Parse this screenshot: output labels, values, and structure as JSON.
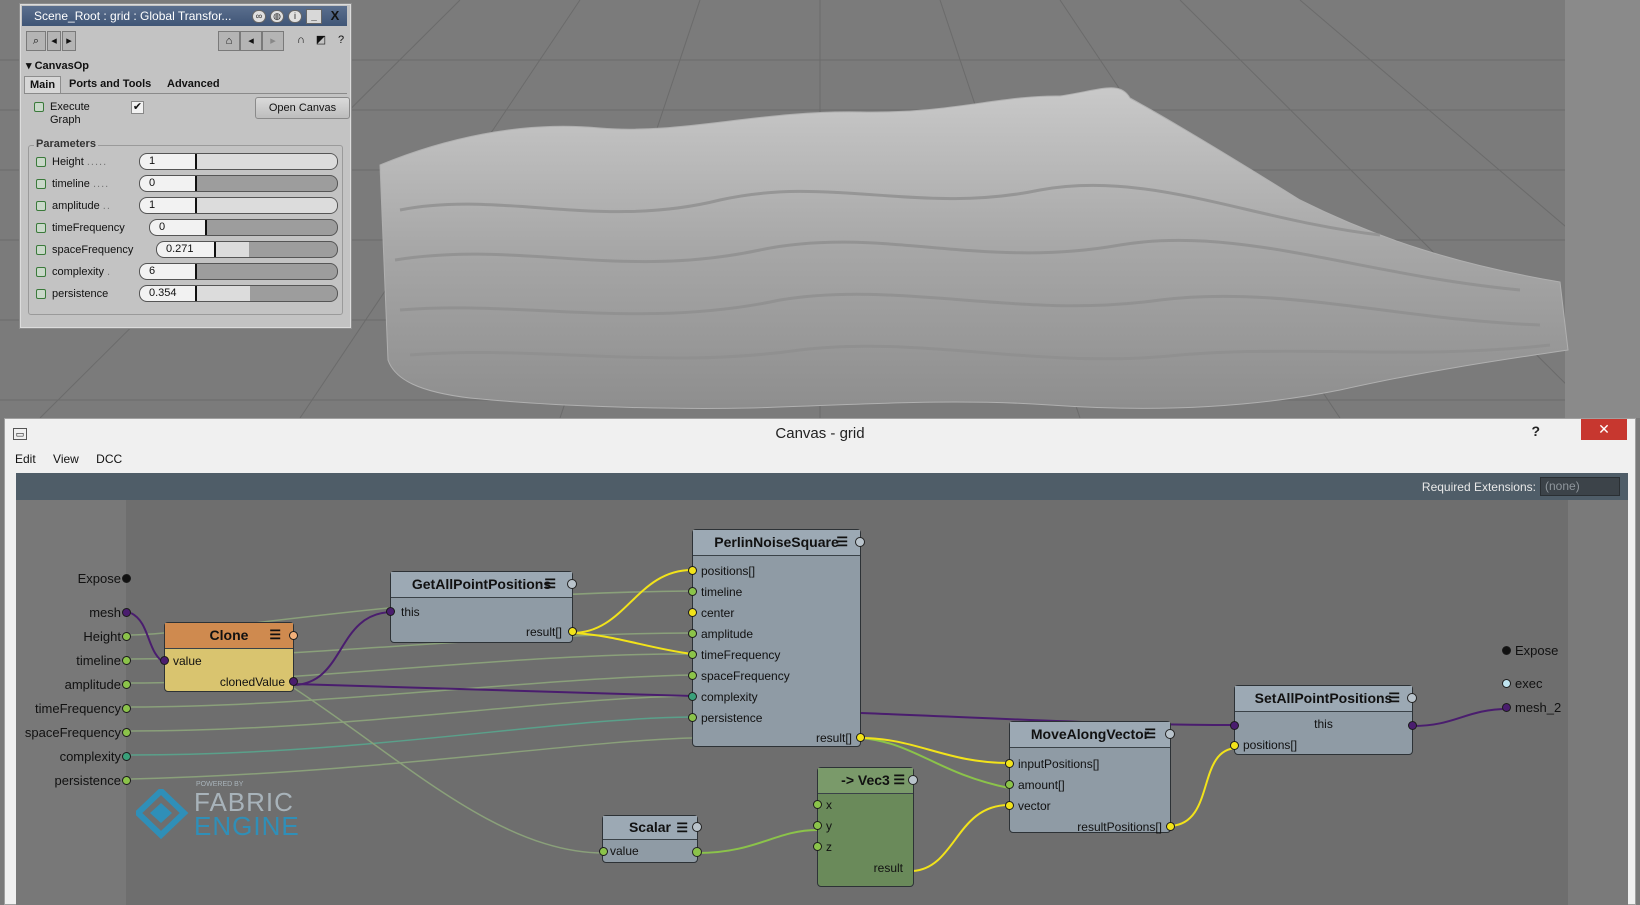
{
  "prop_panel": {
    "title": "Scene_Root : grid : Global Transfor...",
    "section": "CanvasOp",
    "tabs": [
      "Main",
      "Ports and Tools",
      "Advanced"
    ],
    "execute_label": "Execute Graph",
    "execute_checked": "✔",
    "open_canvas": "Open Canvas",
    "parameters_title": "Parameters",
    "params": [
      {
        "name": "Height",
        "value": "1"
      },
      {
        "name": "timeline",
        "value": "0"
      },
      {
        "name": "amplitude",
        "value": "1"
      },
      {
        "name": "timeFrequency",
        "value": "0"
      },
      {
        "name": "spaceFrequency",
        "value": "0.271"
      },
      {
        "name": "complexity",
        "value": "6"
      },
      {
        "name": "persistence",
        "value": "0.354"
      }
    ]
  },
  "canvas_window": {
    "title": "Canvas - grid",
    "help": "?",
    "close": "✕",
    "menu": [
      "Edit",
      "View",
      "DCC"
    ],
    "required_extensions_label": "Required Extensions:",
    "required_extensions_value": "(none)"
  },
  "graph": {
    "left_ports": [
      "Expose",
      "mesh",
      "Height",
      "timeline",
      "amplitude",
      "timeFrequency",
      "spaceFrequency",
      "complexity",
      "persistence"
    ],
    "right_ports": [
      "Expose",
      "exec",
      "mesh_2"
    ],
    "nodes": {
      "clone": {
        "title": "Clone",
        "in": "value",
        "out": "clonedValue"
      },
      "get_positions": {
        "title": "GetAllPointPositions",
        "in": "this",
        "out": "result[]"
      },
      "perlin": {
        "title": "PerlinNoiseSquare",
        "ins": [
          "positions[]",
          "timeline",
          "center",
          "amplitude",
          "timeFrequency",
          "spaceFrequency",
          "complexity",
          "persistence"
        ],
        "out": "result[]"
      },
      "move": {
        "title": "MoveAlongVector",
        "ins": [
          "inputPositions[]",
          "amount[]",
          "vector"
        ],
        "out": "resultPositions[]"
      },
      "set_positions": {
        "title": "SetAllPointPositions",
        "io": "this",
        "in": "positions[]"
      },
      "vec3": {
        "title": "-> Vec3",
        "ins": [
          "x",
          "y",
          "z"
        ],
        "out": "result"
      },
      "scalar": {
        "title": "Scalar",
        "out": "value"
      }
    },
    "logo": {
      "powered": "POWERED BY",
      "line1": "FABRIC",
      "line2": "ENGINE"
    }
  },
  "colors": {
    "viewport_bg": "#7a7a7a",
    "graph_bg": "#6e6e6e",
    "clone_header": "#cf8a4f",
    "clone_body": "#d9c46f",
    "node_header": "#9ca9b4",
    "node_body": "#8f9ba5",
    "vec3_body": "#6a8a5a",
    "wire_yellow": "#f2e31a",
    "wire_purple": "#4a1d6e",
    "wire_green": "#9bc46a"
  }
}
